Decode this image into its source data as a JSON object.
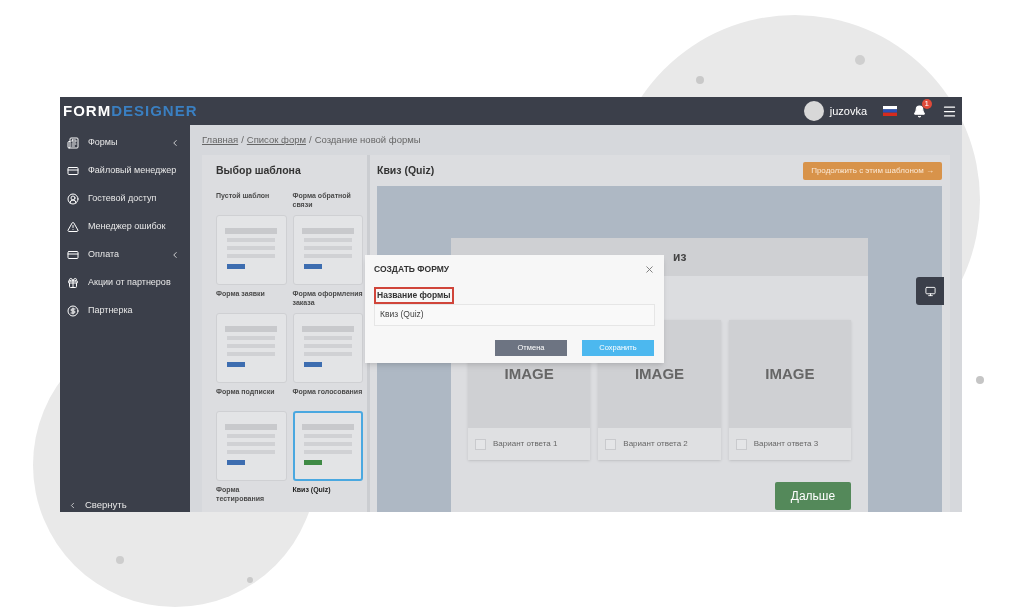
{
  "header": {
    "logo_part_1": "FORM",
    "logo_part_2": "DESIGNER",
    "user": "juzovka",
    "notifications": "1"
  },
  "sidebar": {
    "items": [
      {
        "label": "Формы",
        "expandable": true
      },
      {
        "label": "Файловый менеджер",
        "expandable": false
      },
      {
        "label": "Гостевой доступ",
        "expandable": false
      },
      {
        "label": "Менеджер ошибок",
        "expandable": false
      },
      {
        "label": "Оплата",
        "expandable": true
      },
      {
        "label": "Акции от партнеров",
        "expandable": false
      },
      {
        "label": "Партнерка",
        "expandable": false
      }
    ],
    "collapse": "Свернуть"
  },
  "breadcrumb": {
    "separator": "/",
    "items": [
      {
        "label": "Главная",
        "link": true
      },
      {
        "label": "Список форм",
        "link": true
      },
      {
        "label": "Создание новой формы",
        "link": false
      }
    ]
  },
  "templates": {
    "title": "Выбор шаблона",
    "items": [
      {
        "label": "Пустой шаблон",
        "selected": false
      },
      {
        "label": "Форма обратной связи",
        "selected": false
      },
      {
        "label": "Форма заявки",
        "selected": false
      },
      {
        "label": "Форма оформления заказа",
        "selected": false
      },
      {
        "label": "Форма подписки",
        "selected": false
      },
      {
        "label": "Форма голосования",
        "selected": false
      },
      {
        "label": "Форма тестирования",
        "selected": false
      },
      {
        "label": "Квиз (Quiz)",
        "selected": true
      }
    ]
  },
  "preview": {
    "title": "Квиз (Quiz)",
    "continue_button": "Продолжить с этим шаблоном →",
    "quiz_title": "из",
    "answers": [
      {
        "image": "IMAGE",
        "label": "Вариант ответа 1",
        "checked": false
      },
      {
        "image": "IMAGE",
        "label": "Вариант ответа 2",
        "checked": false
      },
      {
        "image": "IMAGE",
        "label": "Вариант ответа 3",
        "checked": false
      }
    ],
    "next_button": "Дальше"
  },
  "dialog": {
    "title": "СОЗДАТЬ ФОРМУ",
    "field_label": "Название формы",
    "field_value": "Квиз (Quiz)",
    "cancel": "Отмена",
    "save": "Сохранить"
  }
}
